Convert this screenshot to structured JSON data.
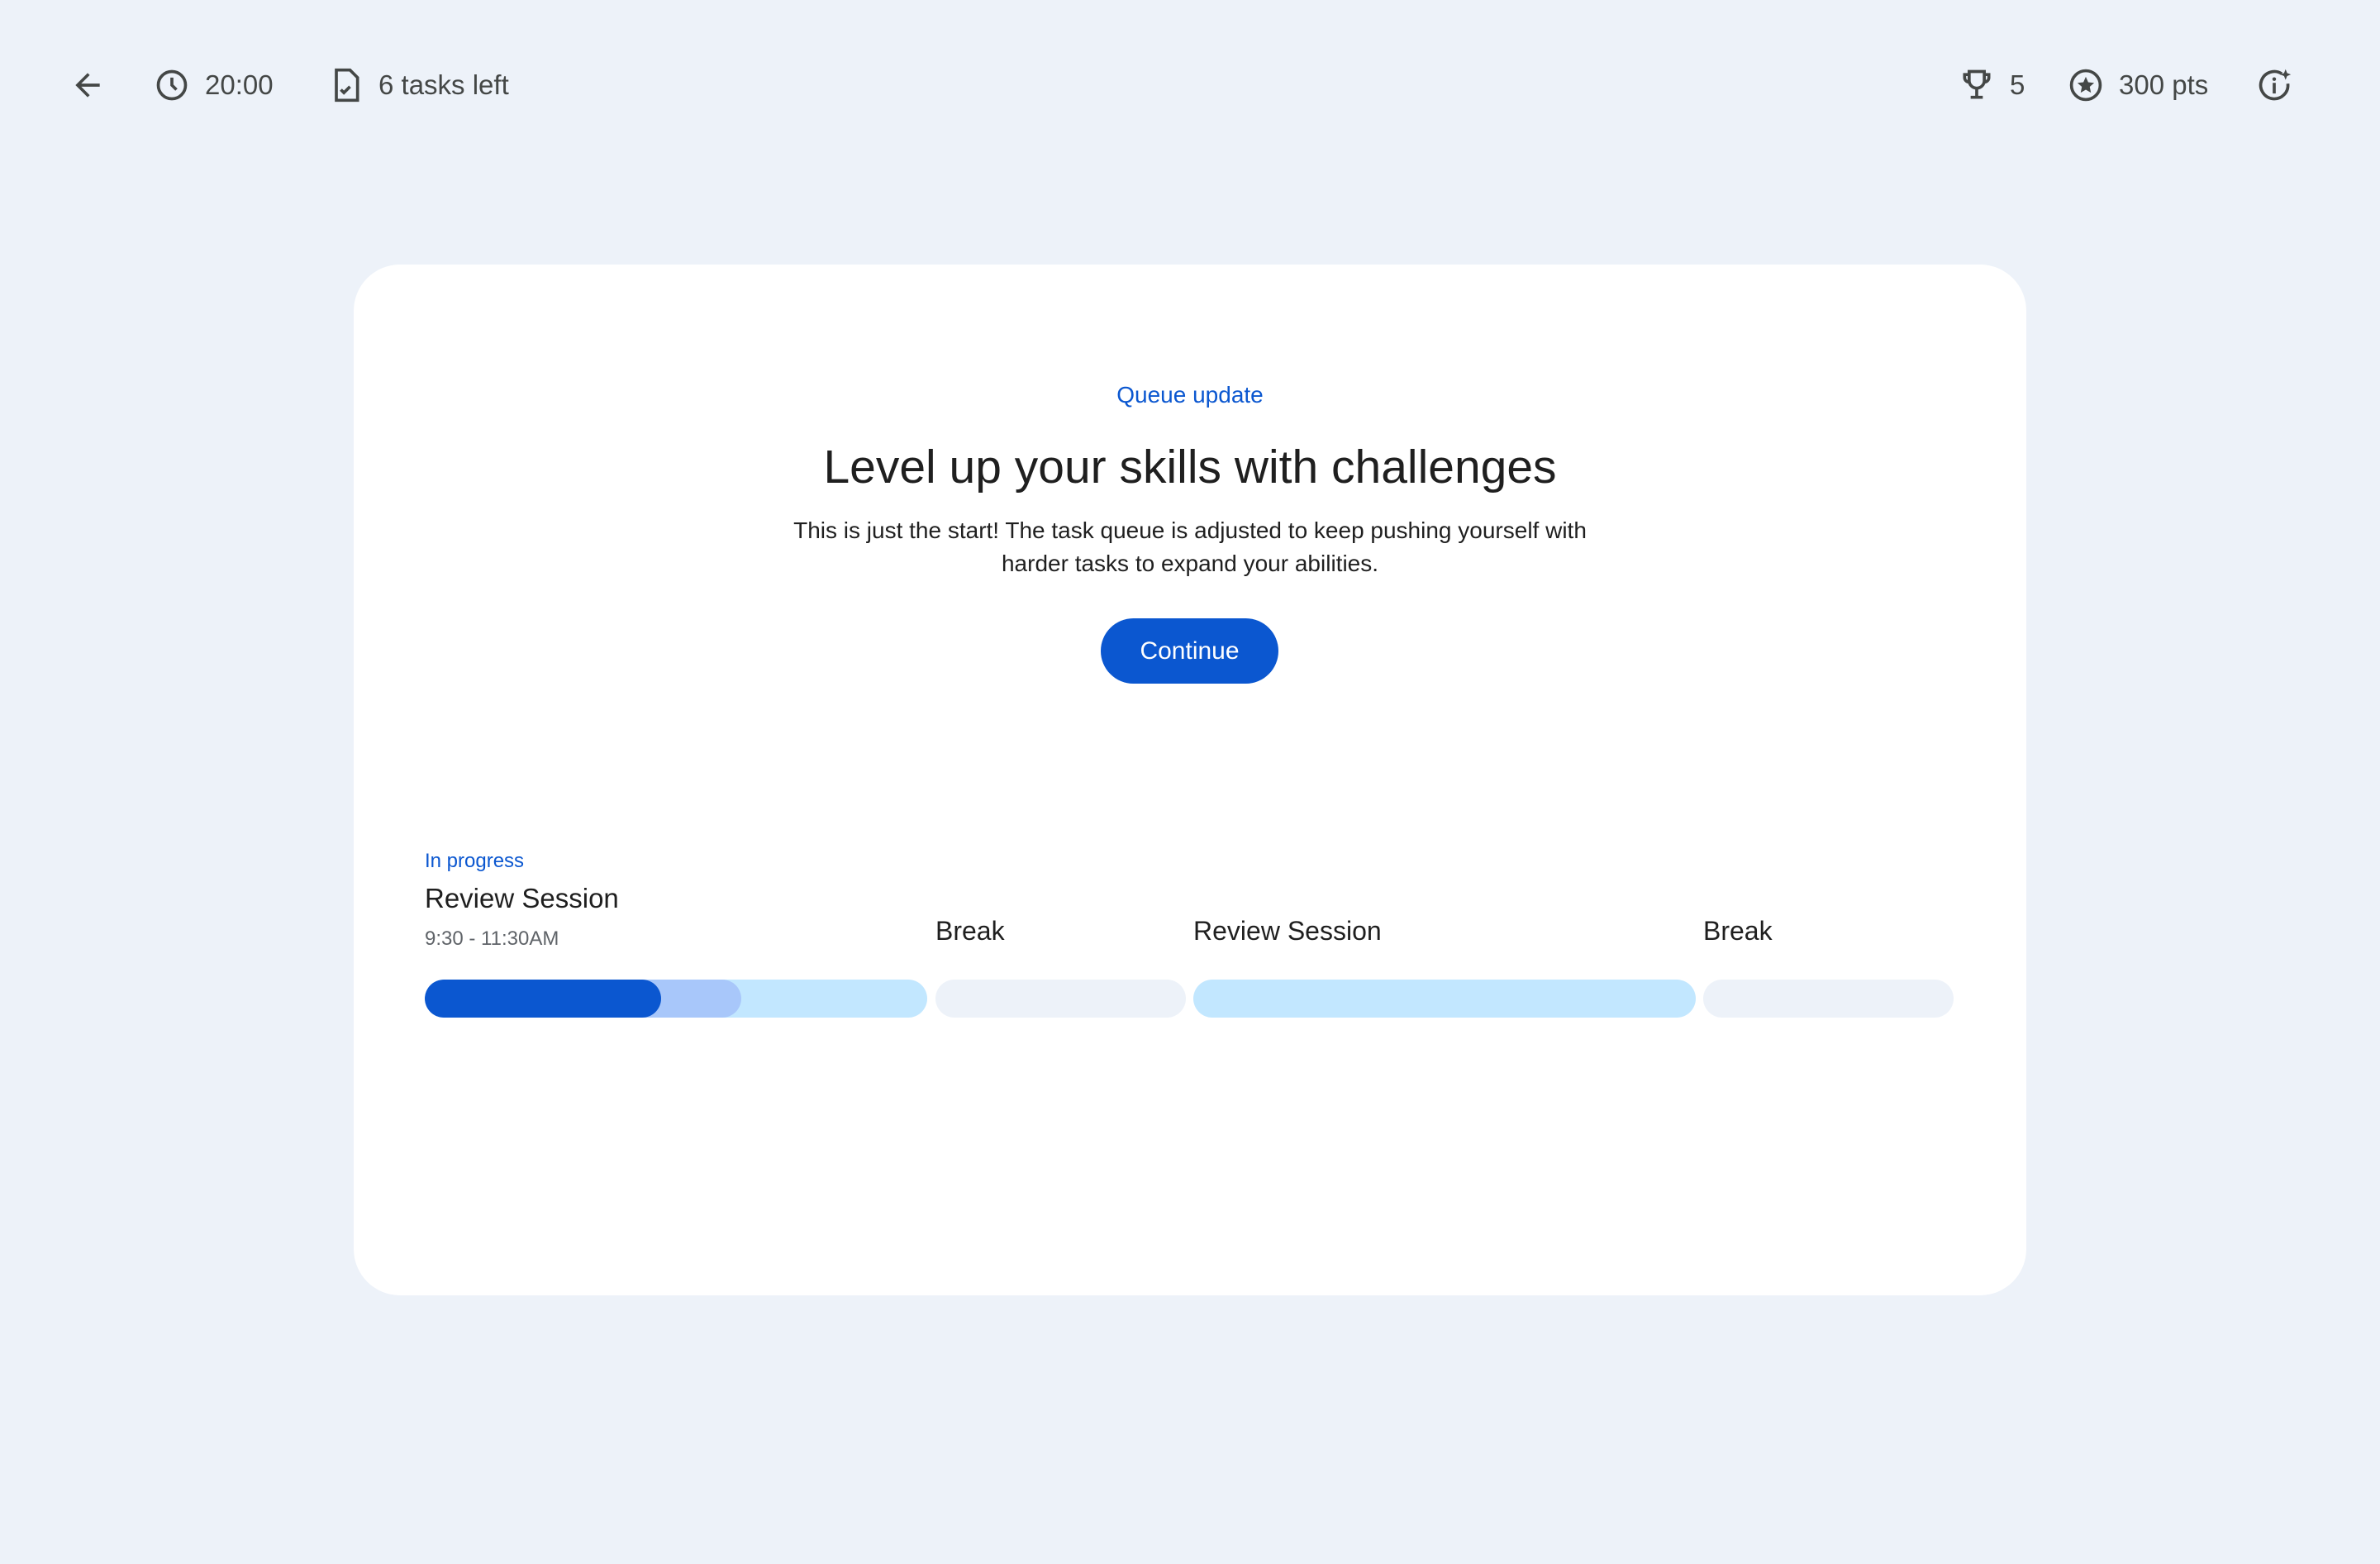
{
  "topbar": {
    "timer": "20:00",
    "tasks_left": "6 tasks left",
    "trophies": "5",
    "points": "300 pts"
  },
  "card": {
    "eyebrow": "Queue update",
    "title": "Level up your skills with challenges",
    "body_line1": "This is just the start! The task queue is adjusted to keep pushing yourself with",
    "body_line2": "harder tasks to expand your abilities.",
    "continue_label": "Continue"
  },
  "schedule": {
    "status": "In progress",
    "current": {
      "title": "Review Session",
      "time": "9:30 - 11:30AM",
      "progress_completed": 0.47,
      "progress_buffered": 0.63
    },
    "segments": [
      {
        "label": "Break"
      },
      {
        "label": "Review Session"
      },
      {
        "label": "Break"
      }
    ]
  },
  "colors": {
    "accent": "#0b57d0",
    "buffered": "#a8c7fa",
    "upcoming": "#c2e7ff",
    "break": "#edf2f9"
  }
}
